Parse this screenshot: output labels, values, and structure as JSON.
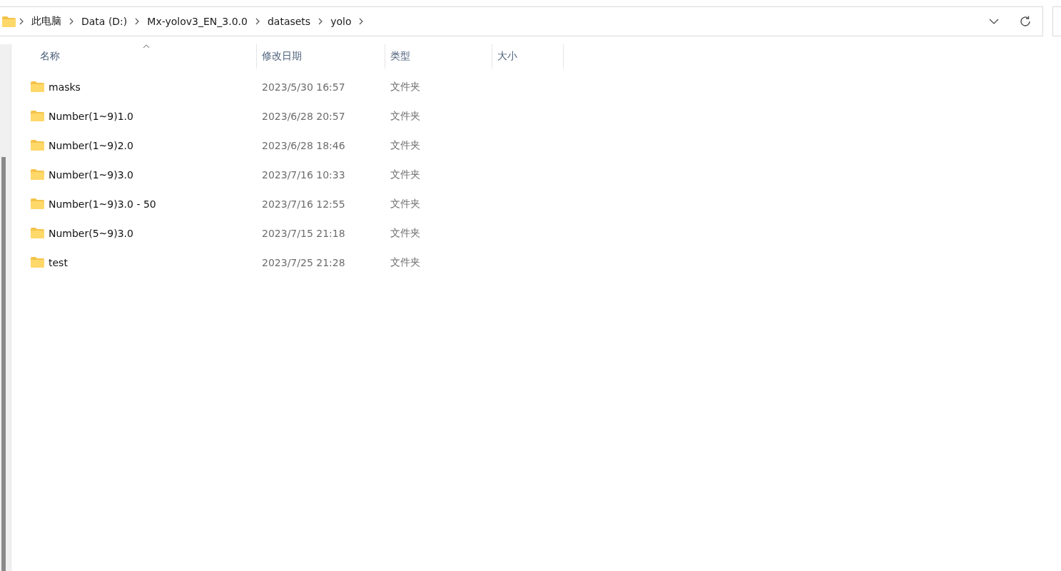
{
  "address_bar": {
    "crumbs": [
      "此电脑",
      "Data (D:)",
      "Mx-yolov3_EN_3.0.0",
      "datasets",
      "yolo"
    ]
  },
  "table": {
    "columns": [
      "名称",
      "修改日期",
      "类型",
      "大小"
    ],
    "rows": [
      {
        "name": "masks",
        "modified": "2023/5/30 16:57",
        "type": "文件夹"
      },
      {
        "name": "Number(1~9)1.0",
        "modified": "2023/6/28 20:57",
        "type": "文件夹"
      },
      {
        "name": "Number(1~9)2.0",
        "modified": "2023/6/28 18:46",
        "type": "文件夹"
      },
      {
        "name": "Number(1~9)3.0",
        "modified": "2023/7/16 10:33",
        "type": "文件夹"
      },
      {
        "name": "Number(1~9)3.0 - 50",
        "modified": "2023/7/16 12:55",
        "type": "文件夹"
      },
      {
        "name": "Number(5~9)3.0",
        "modified": "2023/7/15 21:18",
        "type": "文件夹"
      },
      {
        "name": "test",
        "modified": "2023/7/25 21:28",
        "type": "文件夹"
      }
    ]
  }
}
